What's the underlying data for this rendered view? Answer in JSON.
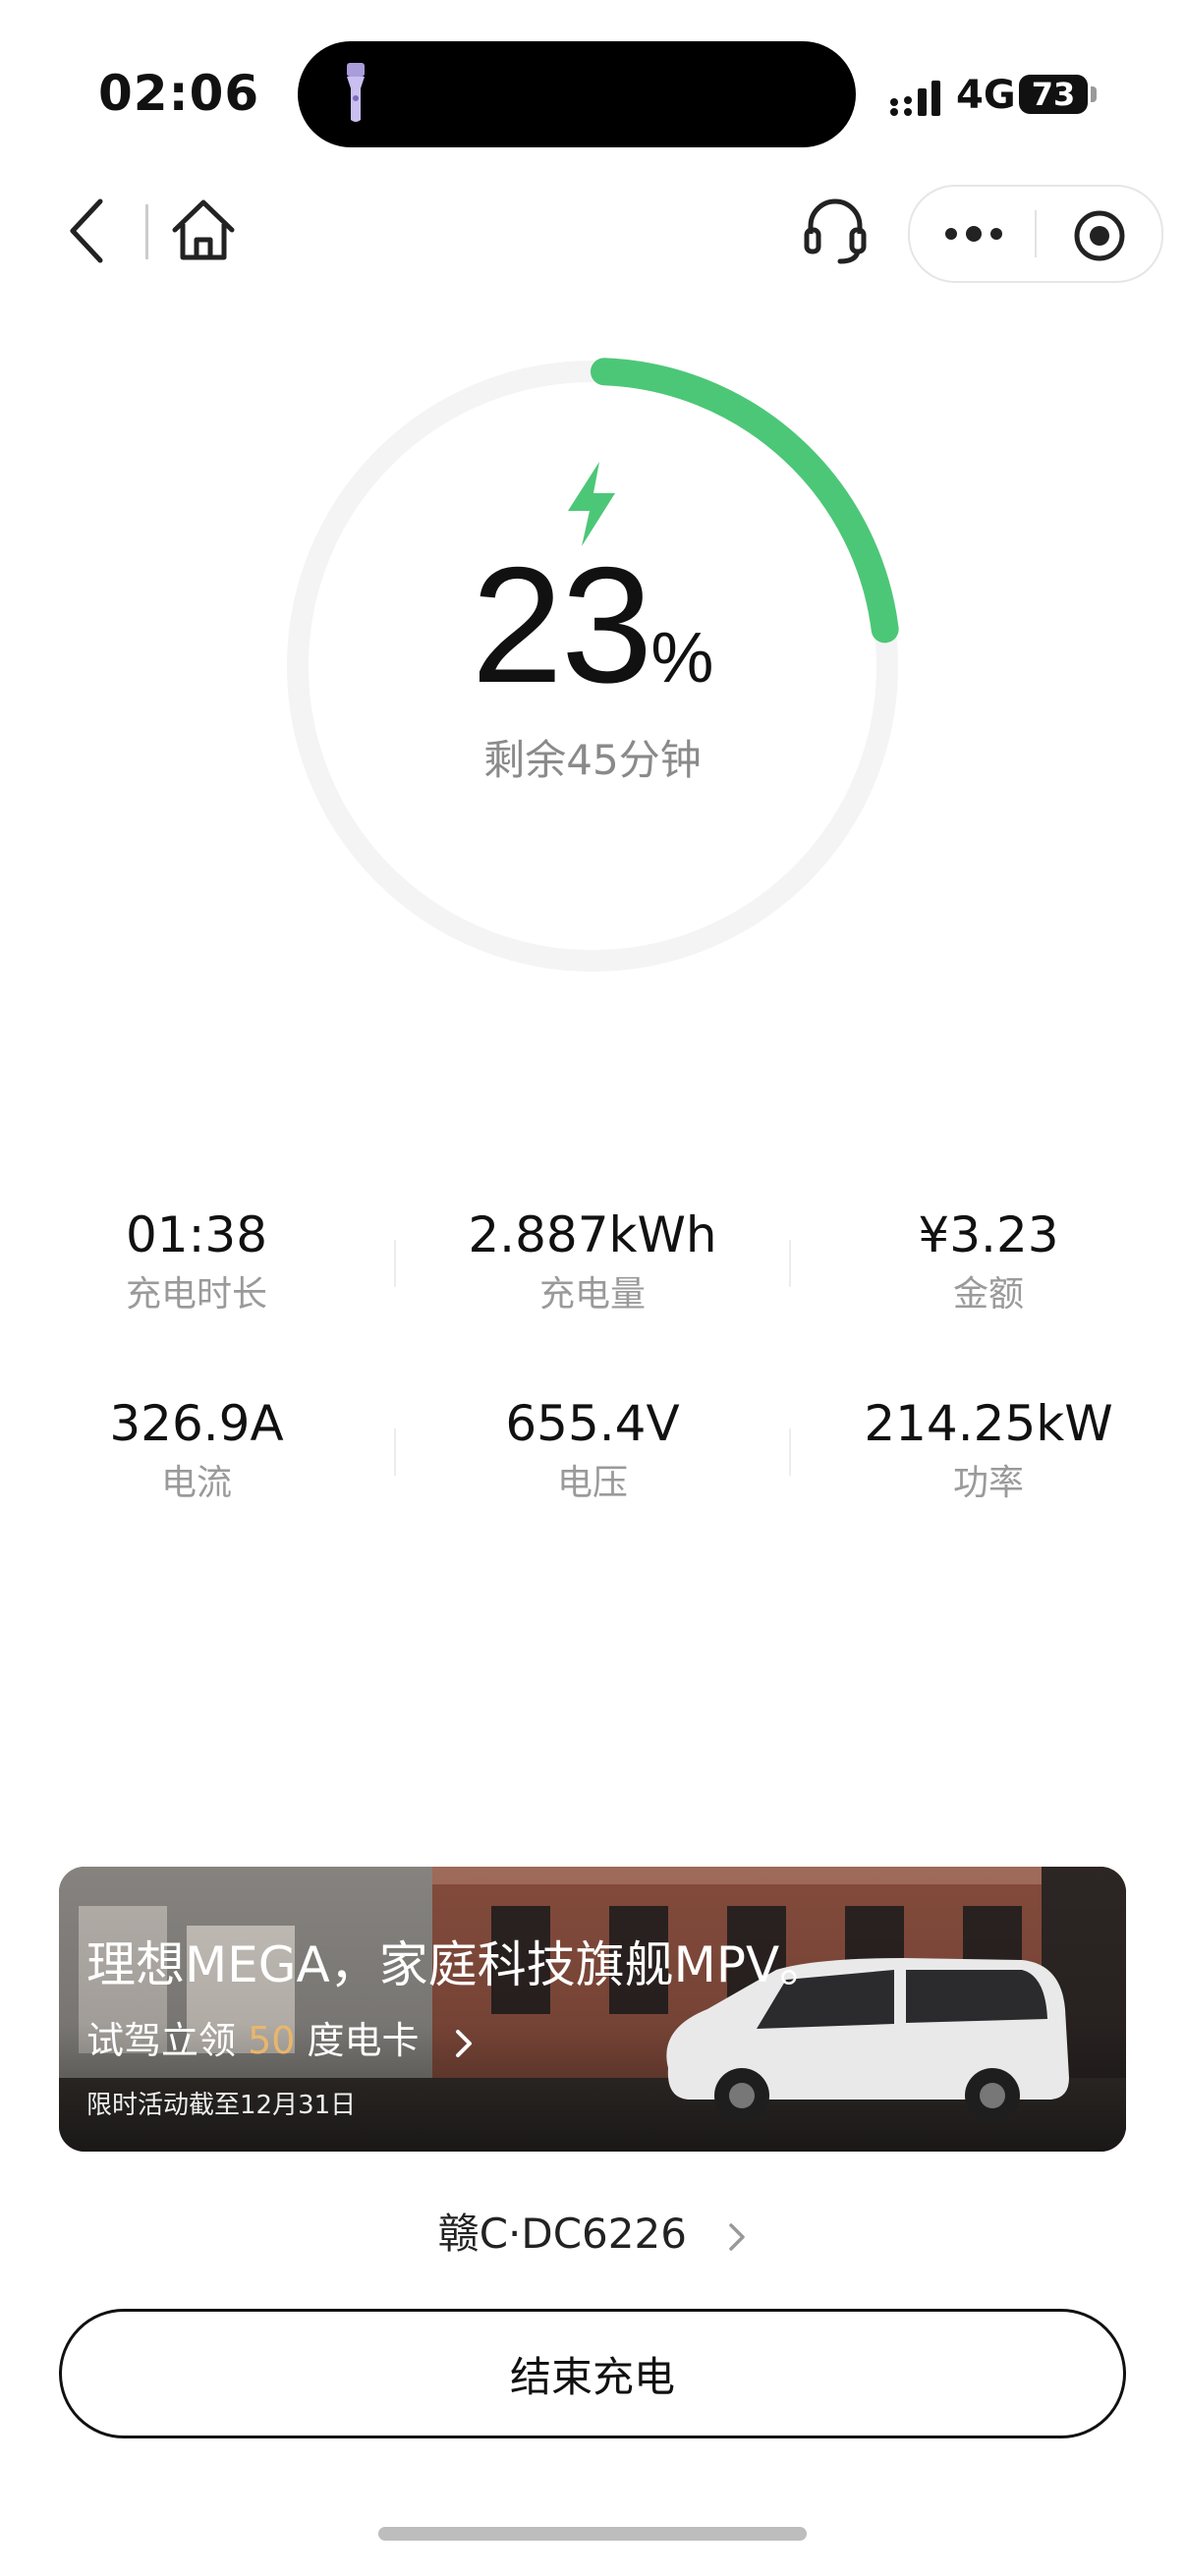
{
  "status_bar": {
    "time": "02:06",
    "network": "4G",
    "battery": "73",
    "icons": [
      "flashlight-icon",
      "signal-icon",
      "battery-icon"
    ]
  },
  "nav": {
    "icons": [
      "back-icon",
      "home-icon",
      "headset-icon",
      "more-icon",
      "target-icon"
    ]
  },
  "charge": {
    "percent": "23",
    "percent_sign": "%",
    "progress": 0.23,
    "remaining": "剩余45分钟",
    "accent_color": "#4cc777",
    "track_color": "#f4f4f4"
  },
  "stats": [
    {
      "value": "01:38",
      "label": "充电时长"
    },
    {
      "value": "2.887kWh",
      "label": "充电量"
    },
    {
      "value": "¥3.23",
      "label": "金额"
    },
    {
      "value": "326.9A",
      "label": "电流"
    },
    {
      "value": "655.4V",
      "label": "电压"
    },
    {
      "value": "214.25kW",
      "label": "功率"
    }
  ],
  "banner": {
    "title": "理想MEGA，家庭科技旗舰MPV。",
    "sub_prefix": "试驾立领 ",
    "sub_highlight": "50",
    "sub_suffix": " 度电卡",
    "note": "限时活动截至12月31日",
    "highlight_color": "#e8b66b"
  },
  "plate": "赣C·DC6226",
  "end_button": "结束充电"
}
